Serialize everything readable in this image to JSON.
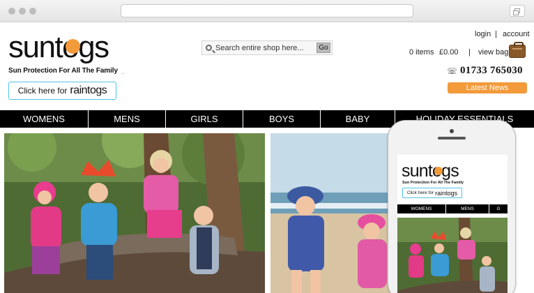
{
  "brand": {
    "logo_text": "suntogs",
    "tagline": "Sun Protection For All The Family",
    "raintogs_button_prefix": "Click here for",
    "raintogs_button_brand": "raintogs",
    "logo_accent_color": "#f39a3a"
  },
  "search": {
    "placeholder": "Search entire shop here...",
    "go_label": "Go"
  },
  "account": {
    "login_label": "login",
    "separator": "|",
    "account_label": "account"
  },
  "cart": {
    "items_text": "0 items",
    "total_text": "£0.00",
    "separator": "|",
    "view_bag_label": "view bag"
  },
  "contact": {
    "phone_icon": "telephone-icon",
    "phone_number": "01733 765030"
  },
  "latest_news_label": "Latest News",
  "nav": {
    "items": [
      "WOMENS",
      "MENS",
      "GIRLS",
      "BOYS",
      "BABY",
      "HOLIDAY ESSENTIALS"
    ]
  },
  "mobile": {
    "logo_text": "suntogs",
    "tagline": "Sun Protection For All The Family",
    "raintogs_button_prefix": "Click here for",
    "raintogs_button_brand": "raintogs",
    "nav": [
      "WOMENS",
      "MENS",
      "G"
    ]
  },
  "colors": {
    "nav_bg": "#000000",
    "accent_orange": "#f39a3a",
    "raintogs_border": "#4fc3e8"
  }
}
